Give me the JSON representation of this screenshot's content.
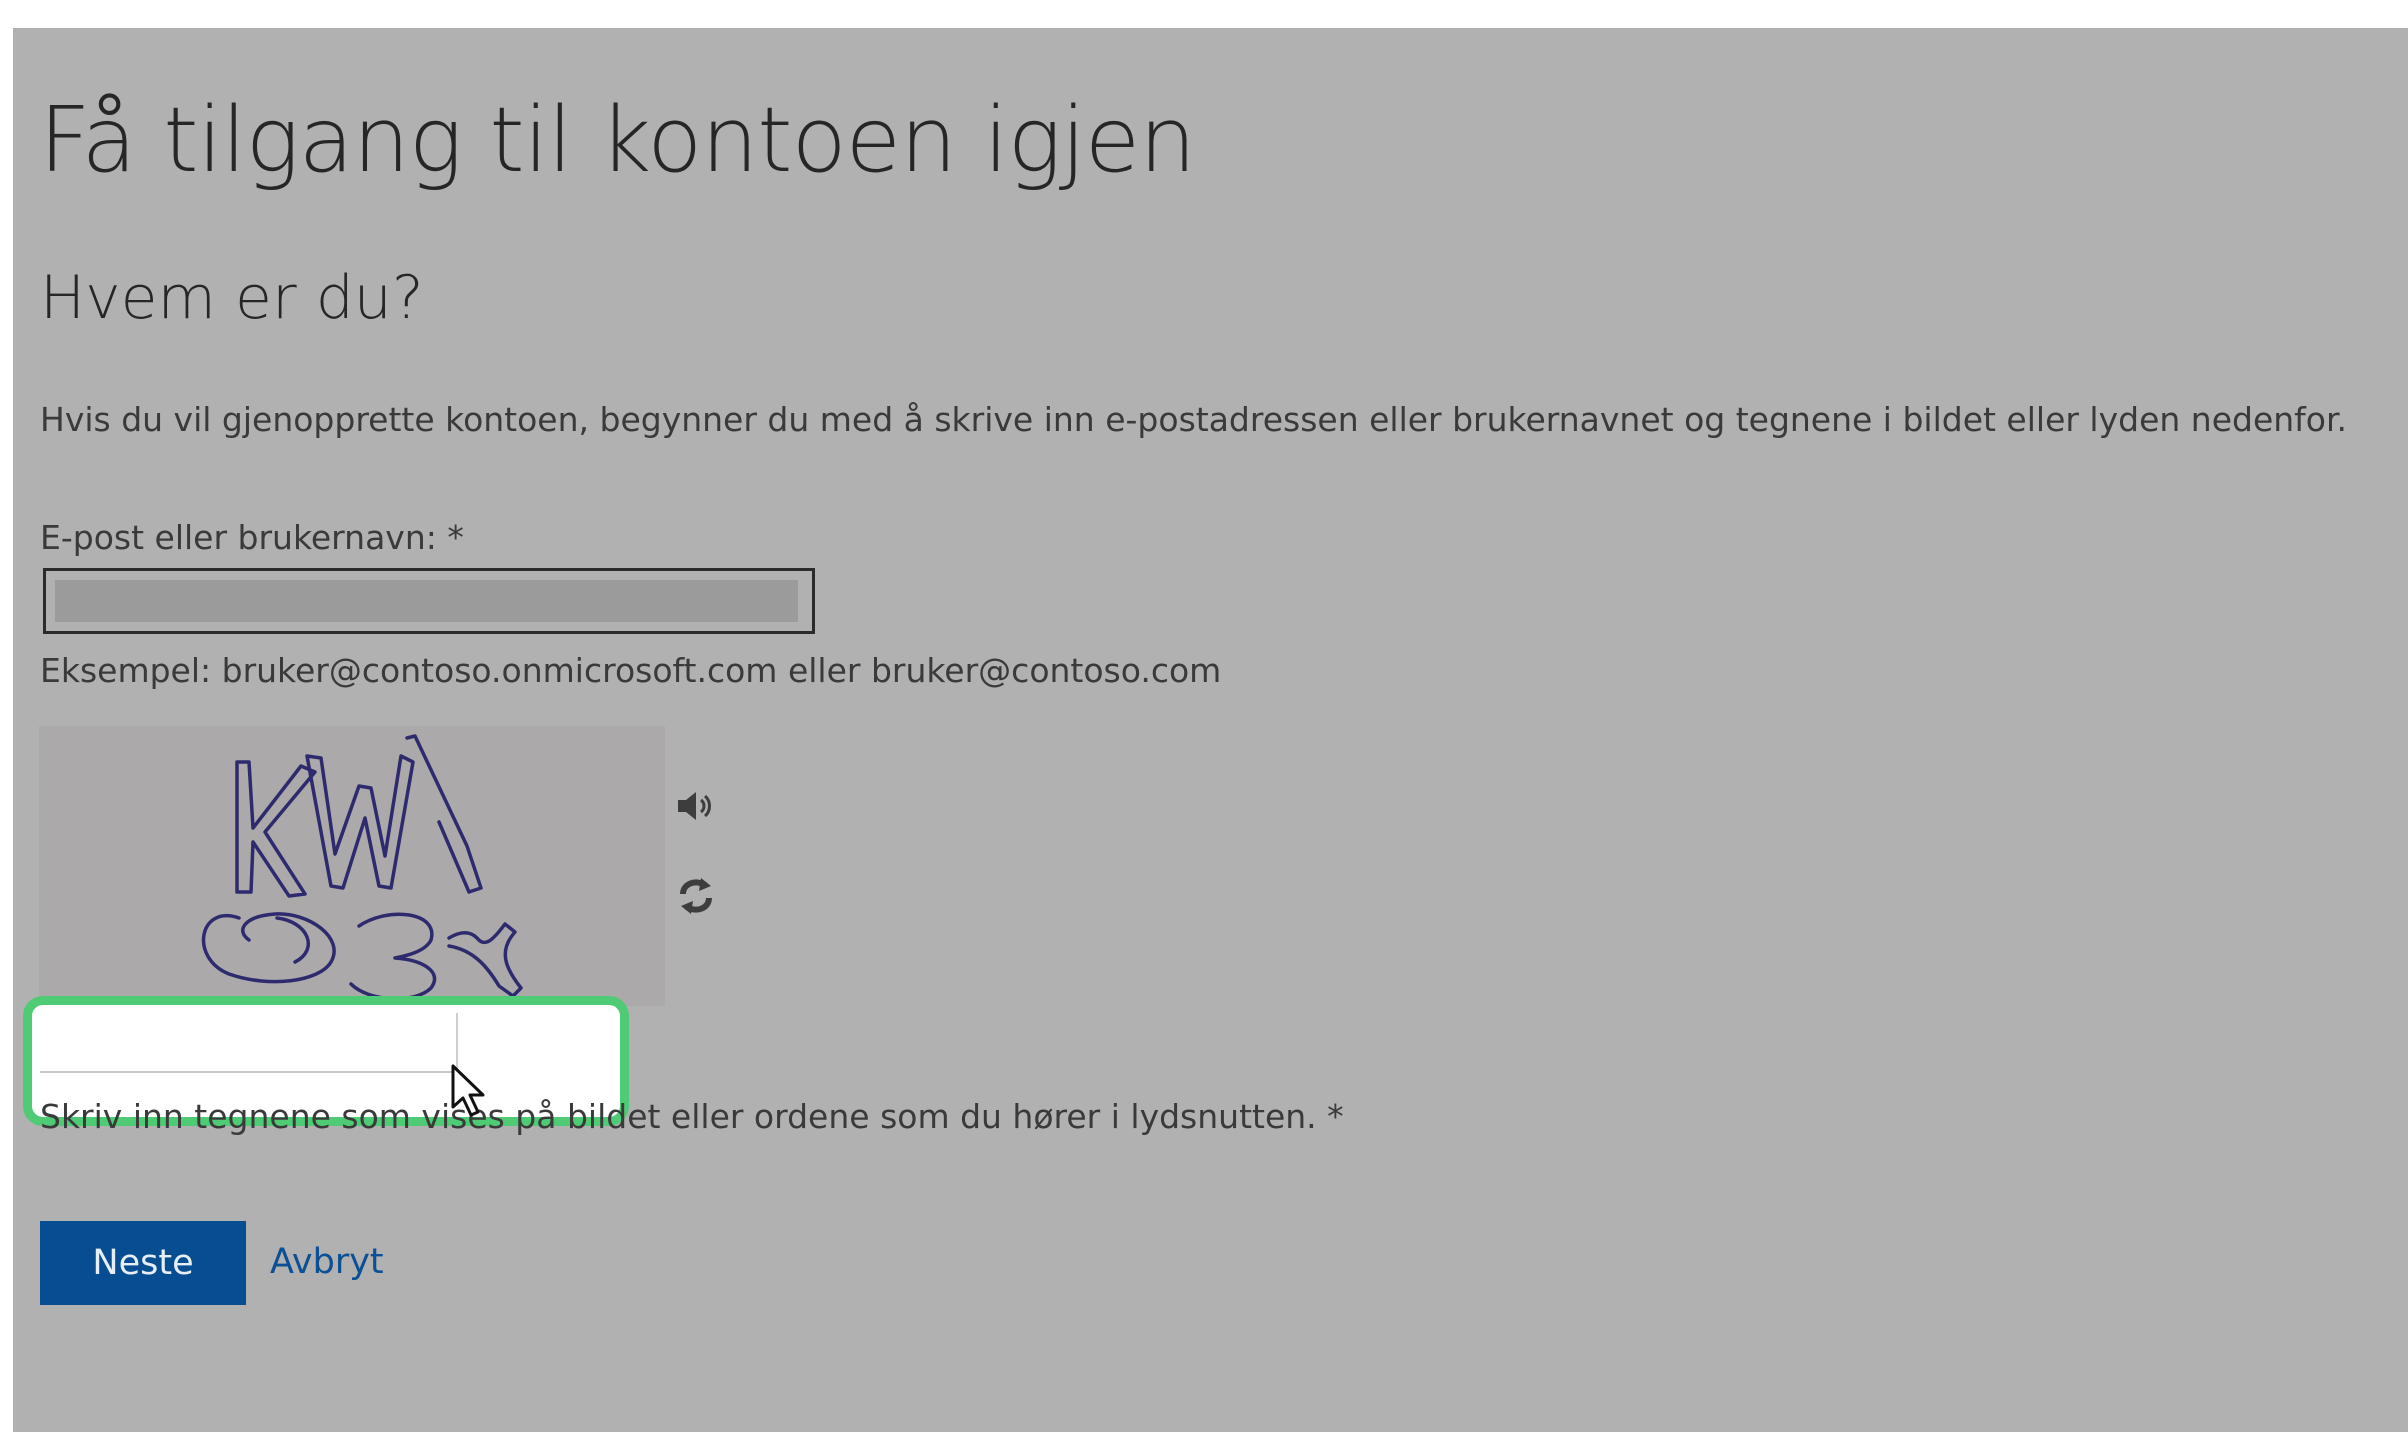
{
  "page": {
    "title": "Få tilgang til kontoen igjen",
    "subtitle": "Hvem er du?",
    "description": "Hvis du vil gjenopprette kontoen, begynner du med å skrive inn e-postadressen eller brukernavnet og tegnene i bildet eller lyden nedenfor."
  },
  "email_field": {
    "label": "E-post eller brukernavn: *",
    "value": "",
    "example": "Eksempel: bruker@contoso.onmicrosoft.com eller bruker@contoso.com"
  },
  "captcha": {
    "image_text": "KW Q3X",
    "sound_icon": "speaker-icon",
    "refresh_icon": "refresh-icon",
    "input_value": "",
    "hint": "Skriv inn tegnene som vises på bildet eller ordene som du hører i lydsnutten. *"
  },
  "actions": {
    "next_label": "Neste",
    "cancel_label": "Avbryt"
  },
  "colors": {
    "overlay_background": "#b1b1b1",
    "highlight": "#4ecb74",
    "primary_button": "#064e91",
    "link": "#0b4f95"
  }
}
